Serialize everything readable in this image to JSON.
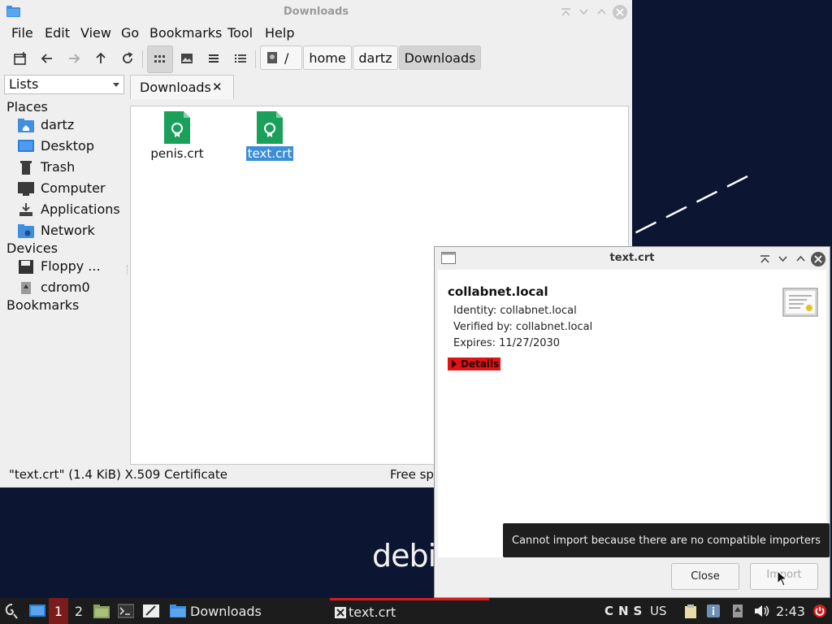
{
  "desktop": {
    "logo_text": "debia"
  },
  "file_manager": {
    "title": "Downloads",
    "menu": [
      "File",
      "Edit",
      "View",
      "Go",
      "Bookmarks",
      "Tool",
      "Help"
    ],
    "path": [
      "/",
      "home",
      "dartz",
      "Downloads"
    ],
    "side_mode": "Lists",
    "sections": {
      "places": "Places",
      "devices": "Devices",
      "bookmarks": "Bookmarks"
    },
    "places": [
      "dartz",
      "Desktop",
      "Trash",
      "Computer",
      "Applications",
      "Network"
    ],
    "devices": [
      "Floppy ...",
      "cdrom0"
    ],
    "tab_label": "Downloads",
    "files": [
      {
        "name": "penis.crt",
        "selected": false
      },
      {
        "name": "text.crt",
        "selected": true
      }
    ],
    "status_left": "\"text.crt\" (1.4 KiB) X.509 Certificate",
    "status_right": "Free sp"
  },
  "cert_dialog": {
    "title": "text.crt",
    "common_name": "collabnet.local",
    "identity": "Identity: collabnet.local",
    "verified_by": "Verified by: collabnet.local",
    "expires": "Expires: 11/27/2030",
    "details_label": "Details",
    "close_label": "Close",
    "import_label": "Import",
    "tooltip": "Cannot import because there are no compatible importers"
  },
  "taskbar": {
    "workspaces": [
      "1",
      "2"
    ],
    "tasks": [
      "Downloads",
      "text.crt"
    ],
    "keyboard": "CNS",
    "layout": "US",
    "clock": "2:43"
  },
  "colors": {
    "selection": "#3a8fd8",
    "details_bg": "#e01414",
    "taskbar_bg": "#1c1c1c",
    "active_accent": "#d81b1b",
    "cert_icon_green": "#1aa05a"
  }
}
